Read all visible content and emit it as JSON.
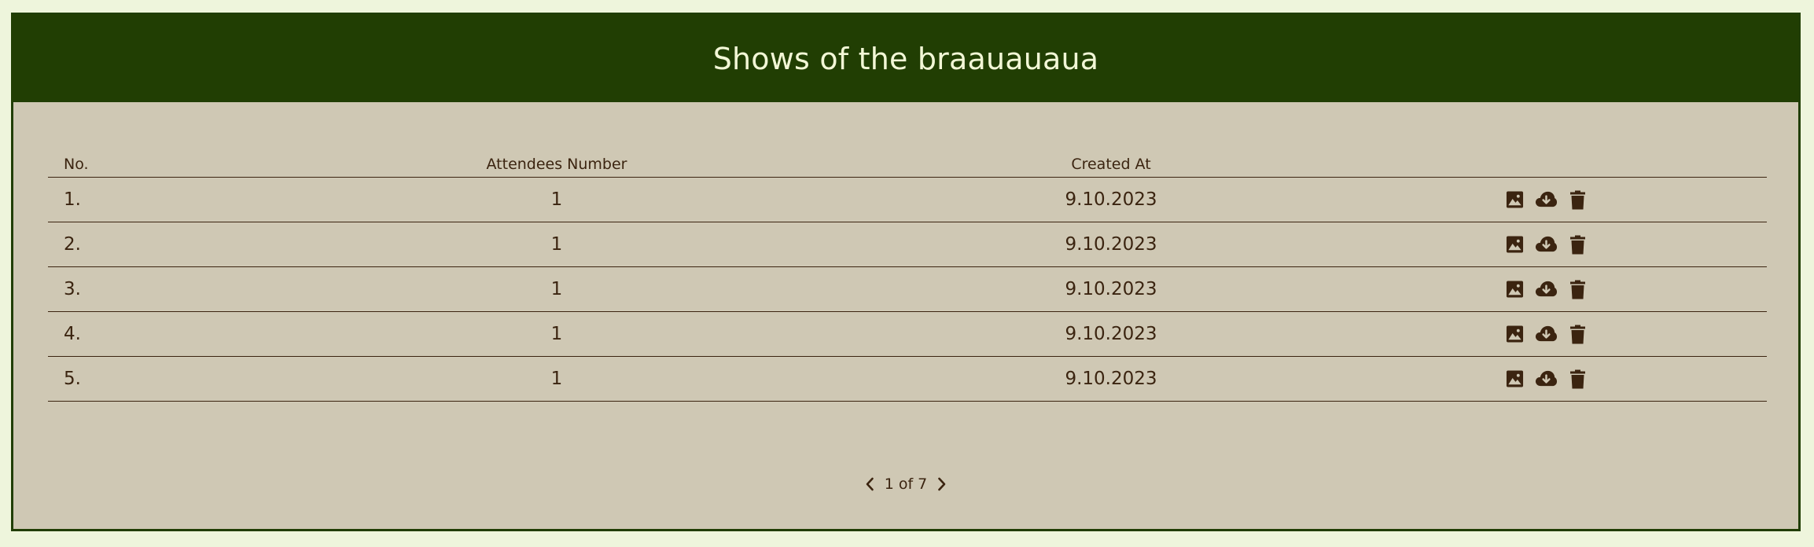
{
  "page": {
    "title": "Shows of the braauauaua"
  },
  "table": {
    "columns": {
      "no": "No.",
      "attendees": "Attendees Number",
      "created_at": "Created At",
      "actions": ""
    },
    "rows": [
      {
        "no": "1.",
        "attendees": "1",
        "created_at": "9.10.2023"
      },
      {
        "no": "2.",
        "attendees": "1",
        "created_at": "9.10.2023"
      },
      {
        "no": "3.",
        "attendees": "1",
        "created_at": "9.10.2023"
      },
      {
        "no": "4.",
        "attendees": "1",
        "created_at": "9.10.2023"
      },
      {
        "no": "5.",
        "attendees": "1",
        "created_at": "9.10.2023"
      }
    ],
    "row_actions": [
      "image-icon",
      "cloud-download-icon",
      "trash-icon"
    ]
  },
  "pagination": {
    "label": "1 of 7",
    "prev_icon": "chevron-left-icon",
    "next_icon": "chevron-right-icon"
  },
  "colors": {
    "header_bg": "#213e03",
    "panel_bg": "#cfc8b4",
    "page_bg": "#eef5dc",
    "text": "#3b2410",
    "title_text": "#f2f7d6"
  }
}
